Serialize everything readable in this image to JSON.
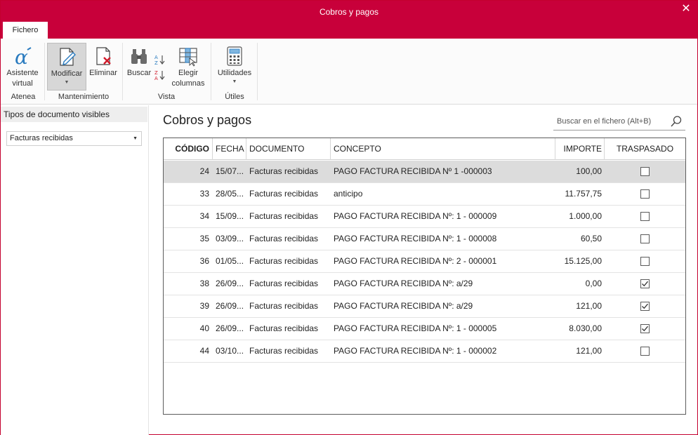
{
  "window": {
    "title": "Cobros y pagos",
    "close_symbol": "✕"
  },
  "ribbon": {
    "tab_file": "Fichero",
    "atenea": {
      "btn_assistant_line1": "Asistente",
      "btn_assistant_line2": "virtual",
      "group": "Atenea"
    },
    "maintenance": {
      "modify": "Modificar",
      "delete": "Eliminar",
      "group": "Mantenimiento"
    },
    "view": {
      "search": "Buscar",
      "choose_line1": "Elegir",
      "choose_line2": "columnas",
      "group": "Vista"
    },
    "utils": {
      "utilities": "Utilidades",
      "group": "Útiles"
    },
    "caret": "▼"
  },
  "left_panel": {
    "header": "Tipos de documento visibles",
    "select_value": "Facturas recibidas",
    "select_arrow": "▼"
  },
  "main": {
    "title": "Cobros y pagos",
    "search_placeholder": "Buscar en el fichero (Alt+B)"
  },
  "table": {
    "columns": [
      "CÓDIGO",
      "FECHA",
      "DOCUMENTO",
      "CONCEPTO",
      "IMPORTE",
      "TRASPASADO"
    ],
    "rows": [
      {
        "codigo": "24",
        "fecha": "15/07...",
        "documento": "Facturas recibidas",
        "concepto": "PAGO FACTURA RECIBIDA Nº 1 -000003",
        "importe": "100,00",
        "traspasado": false,
        "selected": true
      },
      {
        "codigo": "33",
        "fecha": "28/05...",
        "documento": "Facturas recibidas",
        "concepto": "anticipo",
        "importe": "11.757,75",
        "traspasado": false,
        "selected": false
      },
      {
        "codigo": "34",
        "fecha": "15/09...",
        "documento": "Facturas recibidas",
        "concepto": "PAGO FACTURA RECIBIDA Nº: 1 - 000009",
        "importe": "1.000,00",
        "traspasado": false,
        "selected": false
      },
      {
        "codigo": "35",
        "fecha": "03/09...",
        "documento": "Facturas recibidas",
        "concepto": "PAGO FACTURA RECIBIDA Nº: 1 - 000008",
        "importe": "60,50",
        "traspasado": false,
        "selected": false
      },
      {
        "codigo": "36",
        "fecha": "01/05...",
        "documento": "Facturas recibidas",
        "concepto": "PAGO FACTURA RECIBIDA Nº: 2 - 000001",
        "importe": "15.125,00",
        "traspasado": false,
        "selected": false
      },
      {
        "codigo": "38",
        "fecha": "26/09...",
        "documento": "Facturas recibidas",
        "concepto": "PAGO FACTURA RECIBIDA Nº: a/29",
        "importe": "0,00",
        "traspasado": true,
        "selected": false
      },
      {
        "codigo": "39",
        "fecha": "26/09...",
        "documento": "Facturas recibidas",
        "concepto": "PAGO FACTURA RECIBIDA Nº: a/29",
        "importe": "121,00",
        "traspasado": true,
        "selected": false
      },
      {
        "codigo": "40",
        "fecha": "26/09...",
        "documento": "Facturas recibidas",
        "concepto": "PAGO FACTURA RECIBIDA Nº: 1 - 000005",
        "importe": "8.030,00",
        "traspasado": true,
        "selected": false
      },
      {
        "codigo": "44",
        "fecha": "03/10...",
        "documento": "Facturas recibidas",
        "concepto": "PAGO FACTURA RECIBIDA Nº: 1 - 000002",
        "importe": "121,00",
        "traspasado": false,
        "selected": false
      }
    ]
  },
  "colors": {
    "accent": "#c8003a",
    "selected_row": "#dcdcdc"
  }
}
